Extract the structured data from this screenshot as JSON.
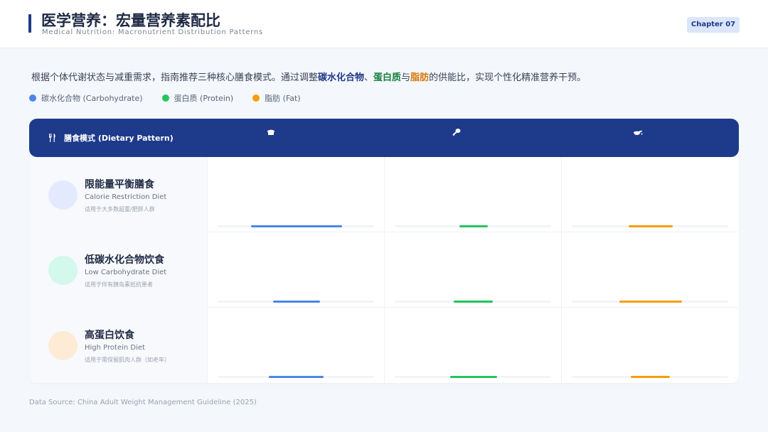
{
  "header": {
    "title": "医学营养：宏量营养素配比",
    "subtitle": "Medical Nutrition: Macronutrient Distribution Patterns",
    "chapter": "Chapter 07"
  },
  "intro": {
    "before": "根据个体代谢状态与减重需求，指南推荐三种核心膳食模式。通过调整",
    "carb": "碳水化合物",
    "sep1": "、",
    "protein": "蛋白质",
    "sep2": "与",
    "fat": "脂肪",
    "after": "的供能比，实现个性化精准营养干预。"
  },
  "legend": [
    {
      "label": "碳水化合物 (Carbohydrate)",
      "color": "#4a86e8"
    },
    {
      "label": "蛋白质 (Protein)",
      "color": "#22c55e"
    },
    {
      "label": "脂肪 (Fat)",
      "color": "#f59e0b"
    }
  ],
  "table": {
    "head_label": "膳食模式 (Dietary Pattern)",
    "head_icons": [
      "bread-icon",
      "drumstick-icon",
      "oil-icon"
    ]
  },
  "chart_data": {
    "type": "table",
    "columns": [
      "Carbohydrate",
      "Protein",
      "Fat"
    ],
    "colors": [
      "#4a86e8",
      "#22c55e",
      "#f59e0b"
    ],
    "rows": [
      {
        "name": "限能量平衡膳食",
        "en": "Calorie Restriction Diet",
        "note": "适用于大多数超重/肥胖人群",
        "circle": "#e4eafd",
        "values": [
          0.58,
          0.18,
          0.28
        ]
      },
      {
        "name": "低碳水化合物饮食",
        "en": "Low Carbohydrate Diet",
        "note": "适用于伴有胰岛素抵抗患者",
        "circle": "#d3f8ec",
        "values": [
          0.3,
          0.25,
          0.4
        ]
      },
      {
        "name": "高蛋白饮食",
        "en": "High Protein Diet",
        "note": "适用于需保留肌肉人群（如老年）",
        "circle": "#fdebd5",
        "values": [
          0.35,
          0.3,
          0.25
        ]
      }
    ]
  },
  "source": "Data Source: China Adult Weight Management Guideline (2025)"
}
